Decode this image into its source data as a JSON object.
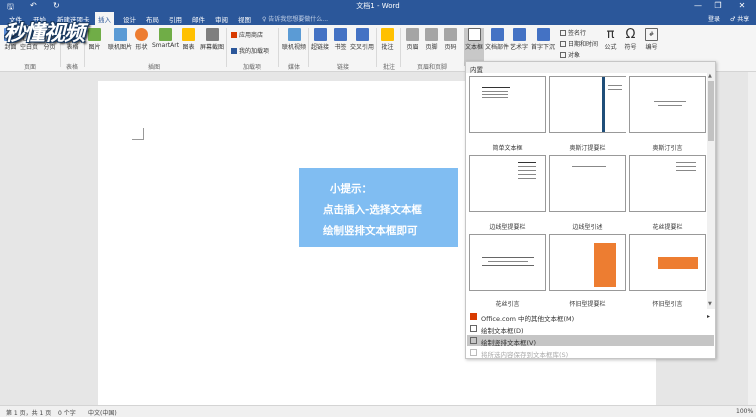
{
  "window": {
    "title": "文档1 - Word",
    "minimize": "—",
    "restore": "❐",
    "close": "✕"
  },
  "quick_access": {
    "save": "🖫",
    "undo": "↶",
    "redo": "↻"
  },
  "tabs": [
    "文件",
    "开始",
    "新建选项卡",
    "插入",
    "设计",
    "布局",
    "引用",
    "邮件",
    "审阅",
    "视图"
  ],
  "active_tab": "插入",
  "tell_me": "♀ 告诉我您想要做什么...",
  "login": "登录",
  "share": "♂ 共享",
  "watermark": "秒懂视频",
  "ribbon": {
    "buttons": [
      {
        "id": "cover",
        "label": "封面",
        "color": "#5b8dd6"
      },
      {
        "id": "blank",
        "label": "空白页",
        "color": "#ffffff"
      },
      {
        "id": "pagebreak",
        "label": "分页",
        "color": "#ffffff"
      },
      {
        "id": "table",
        "label": "表格",
        "color": "#4472c4"
      },
      {
        "id": "picture",
        "label": "图片",
        "color": "#70ad47"
      },
      {
        "id": "online-picture",
        "label": "联机图片",
        "color": "#5b9bd5"
      },
      {
        "id": "shapes",
        "label": "形状",
        "color": "#ed7d31"
      },
      {
        "id": "smartart",
        "label": "SmartArt",
        "color": "#70ad47"
      },
      {
        "id": "chart",
        "label": "图表",
        "color": "#ffc000"
      },
      {
        "id": "screenshot",
        "label": "屏幕截图",
        "color": "#7f7f7f"
      },
      {
        "id": "online-video",
        "label": "联机视频",
        "color": "#5b9bd5"
      },
      {
        "id": "hyperlink",
        "label": "超链接",
        "color": "#4472c4"
      },
      {
        "id": "bookmark",
        "label": "书签",
        "color": "#4472c4"
      },
      {
        "id": "crossref",
        "label": "交叉引用",
        "color": "#4472c4"
      },
      {
        "id": "comment",
        "label": "批注",
        "color": "#ffc000"
      },
      {
        "id": "header",
        "label": "页眉",
        "color": "#a5a5a5"
      },
      {
        "id": "footer",
        "label": "页脚",
        "color": "#a5a5a5"
      },
      {
        "id": "pagenum",
        "label": "页码",
        "color": "#a5a5a5"
      },
      {
        "id": "textbox",
        "label": "文本框",
        "color": "#d9d9d9"
      },
      {
        "id": "docparts",
        "label": "文档部件",
        "color": "#4472c4"
      },
      {
        "id": "wordart",
        "label": "艺术字",
        "color": "#4472c4"
      },
      {
        "id": "dropcap",
        "label": "首字下沉",
        "color": "#4472c4"
      },
      {
        "id": "equation",
        "label": "公式",
        "color": "#333333"
      },
      {
        "id": "symbol",
        "label": "符号",
        "color": "#333333"
      },
      {
        "id": "number",
        "label": "编号",
        "color": "#333333"
      }
    ],
    "addins": {
      "store": "应用商店",
      "my_addins": "我的加载项"
    },
    "text_small": {
      "signature": "签名行",
      "datetime": "日期和时间",
      "object": "对象"
    },
    "groups": [
      "页面",
      "表格",
      "插图",
      "加载项",
      "媒体",
      "链接",
      "批注",
      "页眉和页脚"
    ]
  },
  "tip": {
    "line1": "小提示：",
    "line2": "点击插入-选择文本框",
    "line3": "绘制竖排文本框即可"
  },
  "gallery": {
    "header": "内置",
    "items": [
      "简单文本框",
      "奥斯汀提要栏",
      "奥斯汀引言",
      "边线型提要栏",
      "边线型引述",
      "花丝提要栏",
      "花丝引言",
      "怀旧型提要栏",
      "怀旧型引言"
    ],
    "menu": [
      {
        "label": "Office.com 中的其他文本框(M)",
        "state": "normal",
        "arrow": "▸"
      },
      {
        "label": "绘制文本框(D)",
        "state": "normal"
      },
      {
        "label": "绘制竖排文本框(V)",
        "state": "highlight"
      },
      {
        "label": "将所选内容保存到文本框库(S)",
        "state": "disabled"
      }
    ]
  },
  "status": {
    "page": "第 1 页，共 1 页",
    "words": "0 个字",
    "lang": "中文(中国)",
    "zoom": "100%"
  }
}
